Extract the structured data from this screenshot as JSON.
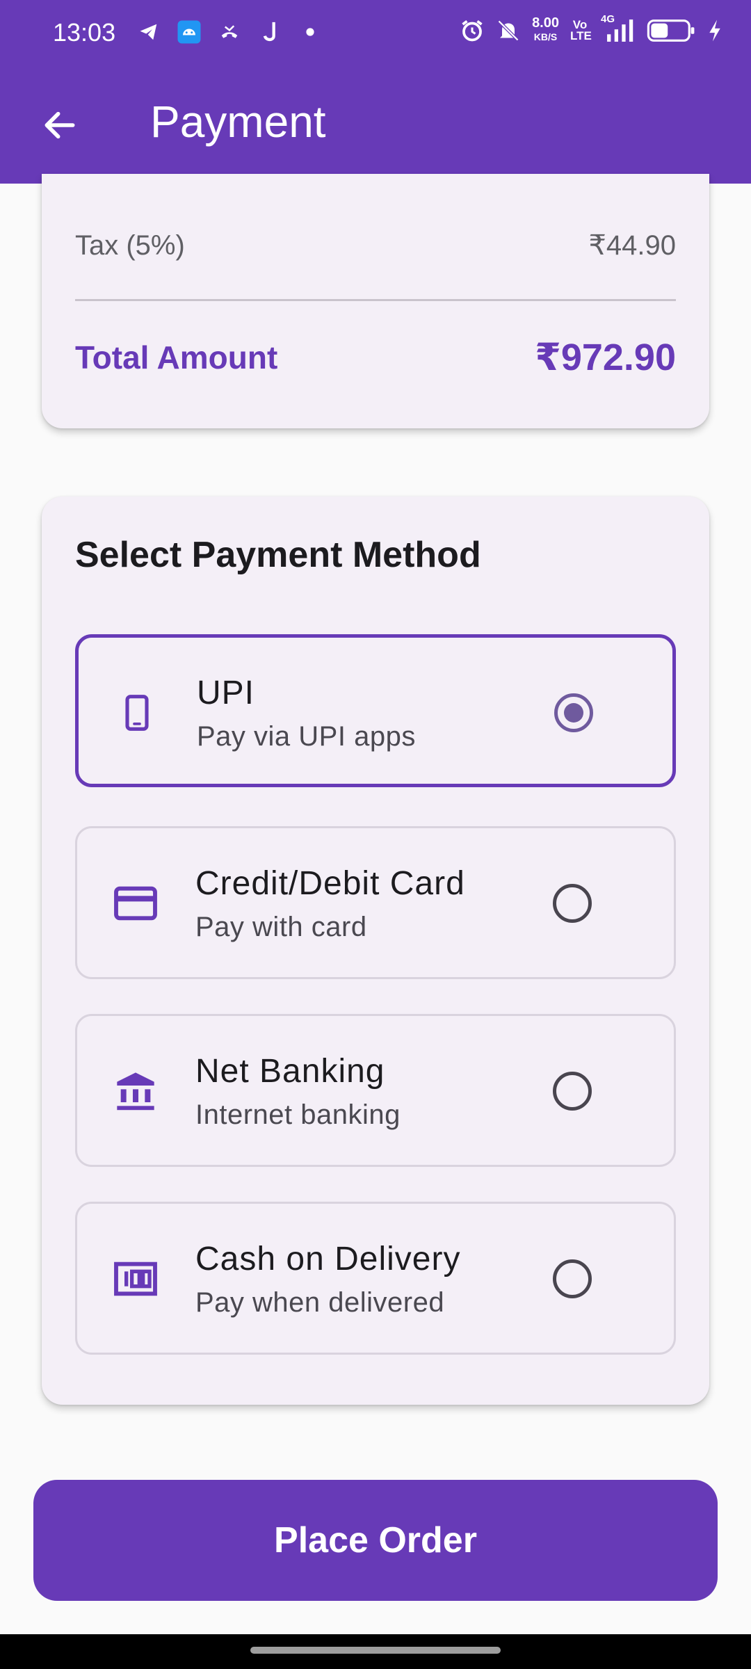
{
  "status_bar": {
    "time": "13:03",
    "net_speed_value": "8.00",
    "net_speed_unit": "KB/S",
    "volte": "Vo LTE",
    "network": "4G",
    "left_icons": [
      "telegram-icon",
      "android-icon",
      "missed-call-icon",
      "j-app-icon",
      "dot-icon"
    ],
    "right_icons": [
      "alarm-icon",
      "mute-icon",
      "signal-icon",
      "battery-icon",
      "charging-icon"
    ]
  },
  "app_bar": {
    "title": "Payment",
    "back_icon": "arrow-back-icon"
  },
  "summary": {
    "tax_label": "Tax (5%)",
    "tax_value": "₹44.90",
    "total_label": "Total Amount",
    "total_value": "₹972.90"
  },
  "payment": {
    "title": "Select Payment Method",
    "options": [
      {
        "title": "UPI",
        "subtitle": "Pay via UPI apps",
        "icon": "phone-icon",
        "selected": true
      },
      {
        "title": "Credit/Debit Card",
        "subtitle": "Pay with card",
        "icon": "credit-card-icon",
        "selected": false
      },
      {
        "title": "Net Banking",
        "subtitle": "Internet banking",
        "icon": "bank-icon",
        "selected": false
      },
      {
        "title": "Cash on Delivery",
        "subtitle": "Pay when delivered",
        "icon": "cash-icon",
        "selected": false
      }
    ]
  },
  "actions": {
    "place_order": "Place Order"
  },
  "colors": {
    "primary": "#673ab7",
    "card_bg": "#f4eff7",
    "page_bg": "#fafafa"
  }
}
